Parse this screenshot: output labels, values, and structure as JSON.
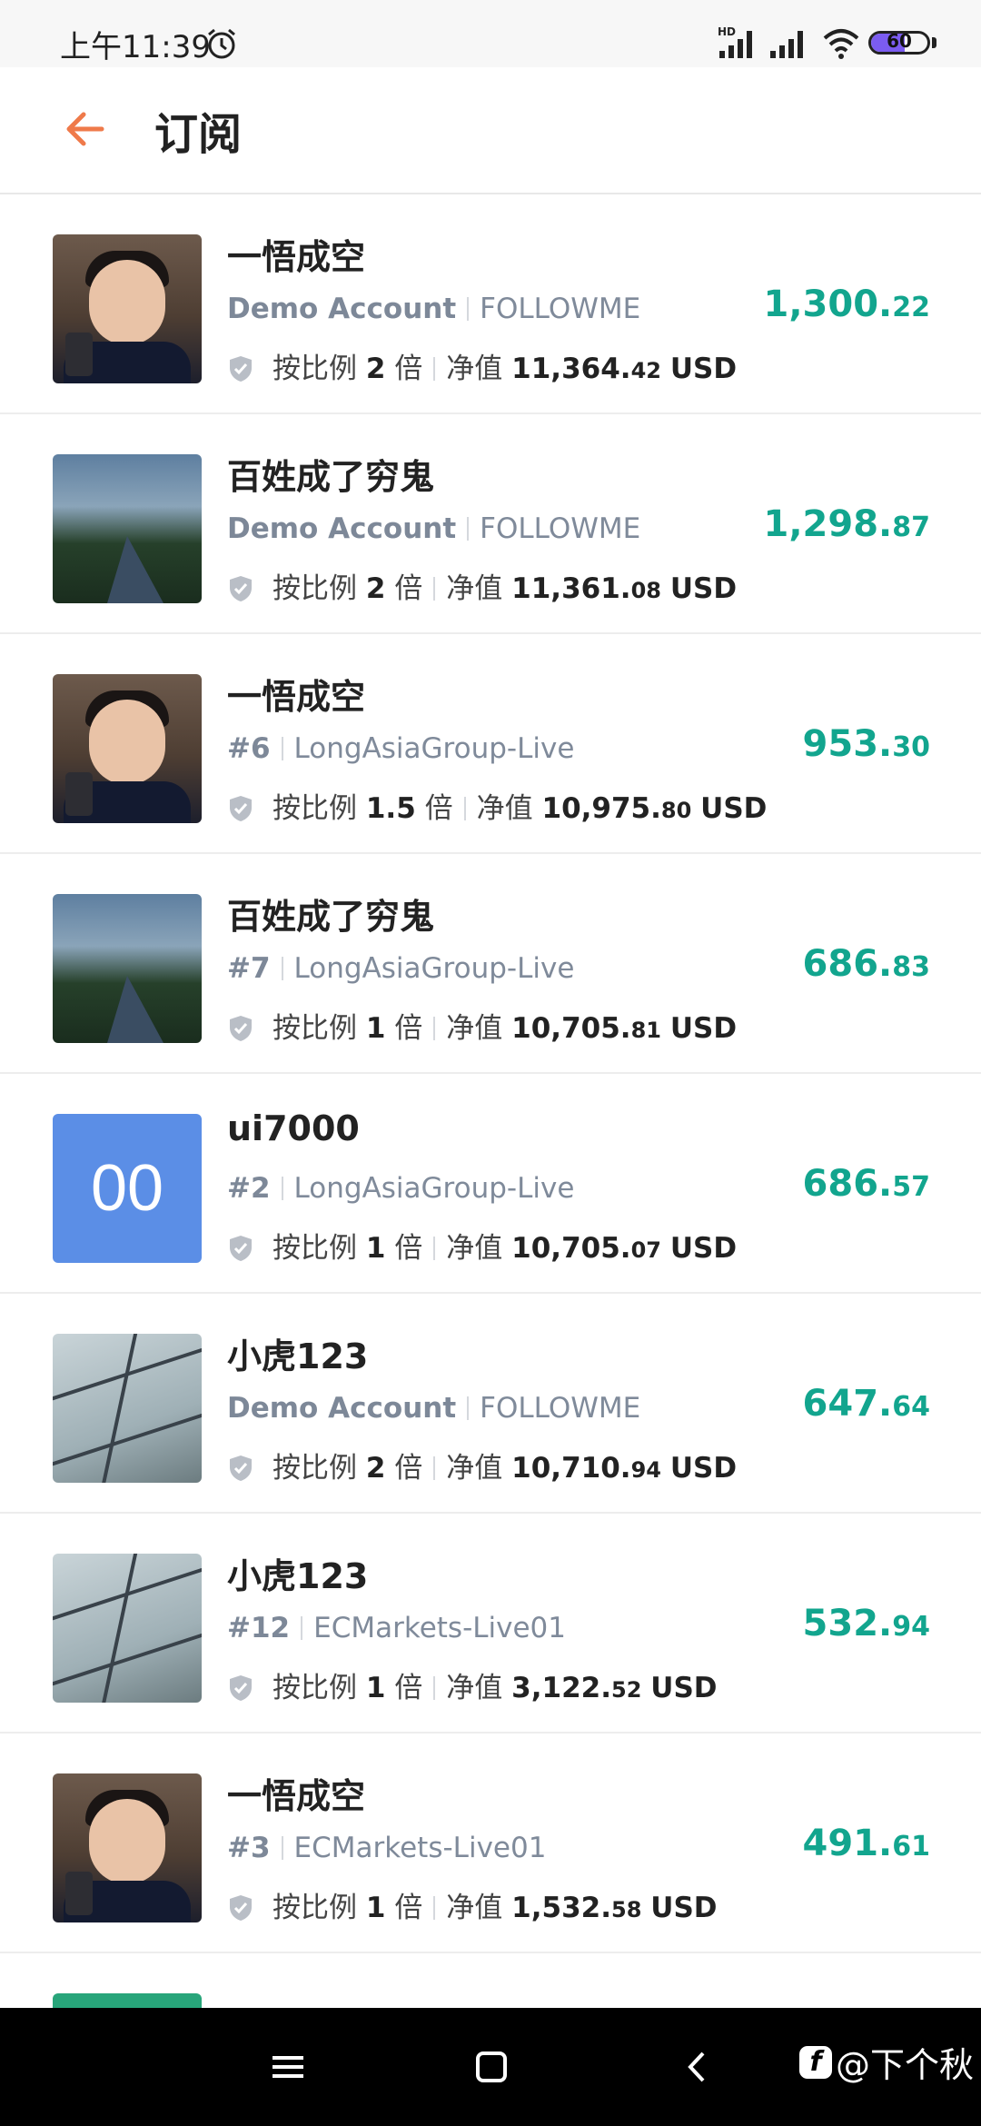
{
  "status_bar": {
    "time": "上午11:39",
    "network_label": "HD",
    "battery": "60",
    "battery_level_percent": 60
  },
  "header": {
    "title": "订阅"
  },
  "rows": [
    {
      "avatar": "boy",
      "name": "一悟成空",
      "tag": "Demo Account",
      "broker": "FOLLOWME",
      "ratio_label": "按比例",
      "ratio": "2",
      "ratio_unit": "倍",
      "equity_label": "净值",
      "equity_int": "11,364.",
      "equity_dec": "42",
      "currency": "USD",
      "profit_int": "1,300.",
      "profit_dec": "22"
    },
    {
      "avatar": "park",
      "name": "百姓成了穷鬼",
      "tag": "Demo Account",
      "broker": "FOLLOWME",
      "ratio_label": "按比例",
      "ratio": "2",
      "ratio_unit": "倍",
      "equity_label": "净值",
      "equity_int": "11,361.",
      "equity_dec": "08",
      "currency": "USD",
      "profit_int": "1,298.",
      "profit_dec": "87"
    },
    {
      "avatar": "boy",
      "name": "一悟成空",
      "tag": "#6",
      "broker": "LongAsiaGroup-Live",
      "ratio_label": "按比例",
      "ratio": "1.5",
      "ratio_unit": "倍",
      "equity_label": "净值",
      "equity_int": "10,975.",
      "equity_dec": "80",
      "currency": "USD",
      "profit_int": "953.",
      "profit_dec": "30"
    },
    {
      "avatar": "park",
      "name": "百姓成了穷鬼",
      "tag": "#7",
      "broker": "LongAsiaGroup-Live",
      "ratio_label": "按比例",
      "ratio": "1",
      "ratio_unit": "倍",
      "equity_label": "净值",
      "equity_int": "10,705.",
      "equity_dec": "81",
      "currency": "USD",
      "profit_int": "686.",
      "profit_dec": "83"
    },
    {
      "avatar": "square",
      "avatar_text": "00",
      "name": "ui7000",
      "tag": "#2",
      "broker": "LongAsiaGroup-Live",
      "ratio_label": "按比例",
      "ratio": "1",
      "ratio_unit": "倍",
      "equity_label": "净值",
      "equity_int": "10,705.",
      "equity_dec": "07",
      "currency": "USD",
      "profit_int": "686.",
      "profit_dec": "57"
    },
    {
      "avatar": "window",
      "name": "小虎123",
      "tag": "Demo Account",
      "broker": "FOLLOWME",
      "ratio_label": "按比例",
      "ratio": "2",
      "ratio_unit": "倍",
      "equity_label": "净值",
      "equity_int": "10,710.",
      "equity_dec": "94",
      "currency": "USD",
      "profit_int": "647.",
      "profit_dec": "64"
    },
    {
      "avatar": "window",
      "name": "小虎123",
      "tag": "#12",
      "broker": "ECMarkets-Live01",
      "ratio_label": "按比例",
      "ratio": "1",
      "ratio_unit": "倍",
      "equity_label": "净值",
      "equity_int": "3,122.",
      "equity_dec": "52",
      "currency": "USD",
      "profit_int": "532.",
      "profit_dec": "94"
    },
    {
      "avatar": "boy",
      "name": "一悟成空",
      "tag": "#3",
      "broker": "ECMarkets-Live01",
      "ratio_label": "按比例",
      "ratio": "1",
      "ratio_unit": "倍",
      "equity_label": "净值",
      "equity_int": "1,532.",
      "equity_dec": "58",
      "currency": "USD",
      "profit_int": "491.",
      "profit_dec": "61"
    }
  ],
  "watermark": {
    "logo": "f",
    "text": "@下个秋"
  },
  "colors": {
    "profit": "#12a58e",
    "back_arrow": "#ef7a4a",
    "square_avatar": "#5b8ee6"
  }
}
